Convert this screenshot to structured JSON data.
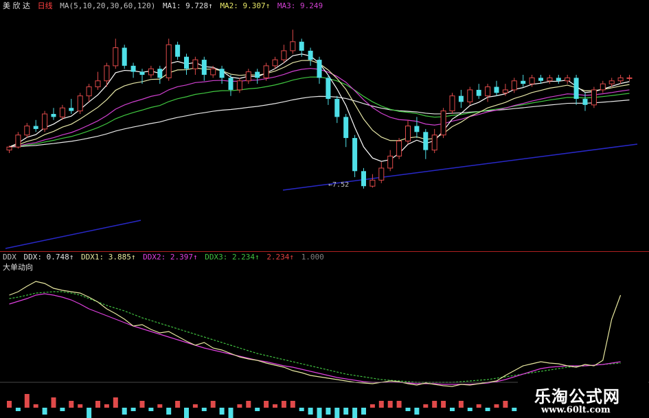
{
  "header": {
    "stock_name": "美 欣 达",
    "period": "日线",
    "ma_def": "MA(5,10,20,30,60,120)",
    "ma1": "MA1: 9.728↑",
    "ma2": "MA2: 9.307↑",
    "ma3": "MA3: 9.249"
  },
  "indicator": {
    "name": "DDX",
    "ddx": "DDX: 0.748↑",
    "ddx1": "DDX1: 3.885↑",
    "ddx2": "DDX2: 2.397↑",
    "ddx3": "DDX3: 2.234↑",
    "v5": "2.234↑",
    "v6": "1.000",
    "subtitle": "大单动向"
  },
  "low_marker": "7.52",
  "watermark": {
    "title": "乐淘公式网",
    "url": "www.60lt.com"
  },
  "colors": {
    "up": "#e04a4a",
    "down": "#4fe0e8",
    "ma5": "#ffffff",
    "ma10": "#e8e8a8",
    "ma20": "#d040d0",
    "ma30": "#40c840",
    "ma60": "#e8e8e8",
    "trend": "#2828c8",
    "ddx2": "#e040e0",
    "ddx3": "#40c040",
    "ddx_line": "#e8e8a0"
  },
  "chart_data": {
    "type": "candlestick",
    "candles": [
      [
        8.8,
        8.9,
        8.95,
        8.7
      ],
      [
        8.9,
        9.3,
        9.4,
        8.85
      ],
      [
        9.3,
        9.6,
        9.7,
        9.2
      ],
      [
        9.6,
        9.5,
        9.8,
        9.4
      ],
      [
        9.5,
        10.0,
        10.1,
        9.4
      ],
      [
        10.0,
        9.9,
        10.2,
        9.8
      ],
      [
        9.9,
        10.2,
        10.3,
        9.8
      ],
      [
        10.2,
        10.1,
        10.5,
        10.0
      ],
      [
        10.1,
        10.6,
        10.7,
        10.0
      ],
      [
        10.6,
        10.9,
        11.0,
        10.4
      ],
      [
        10.9,
        11.1,
        11.4,
        10.8
      ],
      [
        11.1,
        11.6,
        11.7,
        10.9
      ],
      [
        11.6,
        12.2,
        12.5,
        11.5
      ],
      [
        12.2,
        11.6,
        12.3,
        11.5
      ],
      [
        11.6,
        11.4,
        11.7,
        11.2
      ],
      [
        11.4,
        11.3,
        11.5,
        11.0
      ],
      [
        11.3,
        11.5,
        11.6,
        11.2
      ],
      [
        11.5,
        11.2,
        11.6,
        11.0
      ],
      [
        11.2,
        12.3,
        12.5,
        11.1
      ],
      [
        12.3,
        11.9,
        12.4,
        11.8
      ],
      [
        11.9,
        11.5,
        12.0,
        11.3
      ],
      [
        11.5,
        11.8,
        11.9,
        11.3
      ],
      [
        11.8,
        11.3,
        11.9,
        11.1
      ],
      [
        11.3,
        11.5,
        11.6,
        11.2
      ],
      [
        11.5,
        11.2,
        11.6,
        11.0
      ],
      [
        11.2,
        10.8,
        11.3,
        10.6
      ],
      [
        10.8,
        11.1,
        11.2,
        10.7
      ],
      [
        11.1,
        11.4,
        11.5,
        11.0
      ],
      [
        11.4,
        11.2,
        11.5,
        11.0
      ],
      [
        11.2,
        11.6,
        11.7,
        11.1
      ],
      [
        11.6,
        11.8,
        11.9,
        11.5
      ],
      [
        11.8,
        12.1,
        12.3,
        11.7
      ],
      [
        12.1,
        12.4,
        12.8,
        12.0
      ],
      [
        12.4,
        12.1,
        12.5,
        11.9
      ],
      [
        12.1,
        11.8,
        12.2,
        11.6
      ],
      [
        11.8,
        11.2,
        11.9,
        11.0
      ],
      [
        11.2,
        10.5,
        11.3,
        10.3
      ],
      [
        10.5,
        9.9,
        10.6,
        9.7
      ],
      [
        9.9,
        9.2,
        10.0,
        8.9
      ],
      [
        9.2,
        8.1,
        9.3,
        7.9
      ],
      [
        8.1,
        7.6,
        8.2,
        7.52
      ],
      [
        7.6,
        7.8,
        8.0,
        7.55
      ],
      [
        7.8,
        8.2,
        8.4,
        7.7
      ],
      [
        8.2,
        8.6,
        8.8,
        8.1
      ],
      [
        8.6,
        9.1,
        9.2,
        8.5
      ],
      [
        9.1,
        9.6,
        9.8,
        9.0
      ],
      [
        9.6,
        9.4,
        9.9,
        9.2
      ],
      [
        9.4,
        8.8,
        9.5,
        8.5
      ],
      [
        8.8,
        9.3,
        9.5,
        8.7
      ],
      [
        9.3,
        10.1,
        10.2,
        9.2
      ],
      [
        10.1,
        10.6,
        10.7,
        10.0
      ],
      [
        10.6,
        10.4,
        10.8,
        10.2
      ],
      [
        10.4,
        10.8,
        10.9,
        10.3
      ],
      [
        10.8,
        10.6,
        11.0,
        10.5
      ],
      [
        10.6,
        10.9,
        11.0,
        10.4
      ],
      [
        10.9,
        10.7,
        11.1,
        10.6
      ],
      [
        10.7,
        10.8,
        11.0,
        10.6
      ],
      [
        10.8,
        11.1,
        11.2,
        10.7
      ],
      [
        11.1,
        11.0,
        11.3,
        10.9
      ],
      [
        11.0,
        11.2,
        11.3,
        10.9
      ],
      [
        11.2,
        11.1,
        11.3,
        11.0
      ],
      [
        11.1,
        11.2,
        11.3,
        11.0
      ],
      [
        11.2,
        11.1,
        11.3,
        11.0
      ],
      [
        11.1,
        11.2,
        11.3,
        11.0
      ],
      [
        11.2,
        10.5,
        11.3,
        10.3
      ],
      [
        10.5,
        10.3,
        10.7,
        10.1
      ],
      [
        10.3,
        10.8,
        10.9,
        10.2
      ],
      [
        10.8,
        11.0,
        11.1,
        10.7
      ],
      [
        11.0,
        11.1,
        11.2,
        10.9
      ],
      [
        11.1,
        11.2,
        11.3,
        11.0
      ],
      [
        11.2,
        11.2,
        11.3,
        11.1
      ]
    ],
    "volume_bars": [
      2,
      -1,
      4,
      1,
      -2,
      3,
      -1,
      2,
      1,
      -3,
      2,
      1,
      3,
      -2,
      -1,
      2,
      -1,
      1,
      -2,
      2,
      -3,
      1,
      -1,
      2,
      -2,
      -3,
      1,
      2,
      -1,
      2,
      1,
      2,
      2,
      -1,
      -2,
      -3,
      -2,
      -3,
      -2,
      -3,
      -2,
      1,
      2,
      2,
      2,
      -1,
      -2,
      1,
      2,
      2,
      -1,
      2,
      -1,
      1,
      -1,
      1,
      2,
      -1,
      1,
      -1,
      1,
      -1,
      1,
      -3,
      -2,
      2,
      1,
      1,
      1,
      1
    ],
    "ddx_line": [
      1.05,
      1.1,
      1.18,
      1.25,
      1.22,
      1.15,
      1.12,
      1.1,
      1.08,
      1.02,
      0.95,
      0.85,
      0.78,
      0.7,
      0.6,
      0.62,
      0.55,
      0.5,
      0.52,
      0.45,
      0.38,
      0.32,
      0.36,
      0.28,
      0.25,
      0.2,
      0.15,
      0.12,
      0.1,
      0.06,
      0.03,
      0.0,
      -0.05,
      -0.08,
      -0.12,
      -0.14,
      -0.16,
      -0.18,
      -0.2,
      -0.22,
      -0.23,
      -0.24,
      -0.22,
      -0.2,
      -0.21,
      -0.24,
      -0.26,
      -0.23,
      -0.25,
      -0.27,
      -0.28,
      -0.25,
      -0.26,
      -0.24,
      -0.22,
      -0.2,
      -0.12,
      -0.05,
      0.02,
      0.05,
      0.08,
      0.06,
      0.05,
      0.02,
      0.0,
      0.04,
      0.02,
      0.1,
      0.7,
      1.05
    ],
    "ddx2_line": [
      0.92,
      0.96,
      1.0,
      1.05,
      1.07,
      1.05,
      1.02,
      0.98,
      0.92,
      0.85,
      0.8,
      0.75,
      0.7,
      0.65,
      0.6,
      0.56,
      0.52,
      0.48,
      0.44,
      0.4,
      0.36,
      0.32,
      0.28,
      0.25,
      0.22,
      0.19,
      0.16,
      0.13,
      0.1,
      0.08,
      0.05,
      0.02,
      0.0,
      -0.03,
      -0.06,
      -0.09,
      -0.12,
      -0.15,
      -0.17,
      -0.19,
      -0.21,
      -0.22,
      -0.22,
      -0.22,
      -0.22,
      -0.23,
      -0.24,
      -0.24,
      -0.24,
      -0.25,
      -0.25,
      -0.25,
      -0.25,
      -0.24,
      -0.23,
      -0.21,
      -0.18,
      -0.14,
      -0.1,
      -0.06,
      -0.02,
      0.0,
      0.01,
      0.02,
      0.02,
      0.02,
      0.03,
      0.04,
      0.06,
      0.08
    ],
    "ddx3_line": [
      1.0,
      1.02,
      1.05,
      1.08,
      1.09,
      1.1,
      1.1,
      1.08,
      1.05,
      1.0,
      0.95,
      0.9,
      0.86,
      0.82,
      0.77,
      0.72,
      0.68,
      0.64,
      0.6,
      0.56,
      0.52,
      0.48,
      0.44,
      0.4,
      0.36,
      0.32,
      0.28,
      0.24,
      0.2,
      0.17,
      0.14,
      0.11,
      0.08,
      0.05,
      0.02,
      -0.01,
      -0.04,
      -0.07,
      -0.1,
      -0.12,
      -0.14,
      -0.16,
      -0.18,
      -0.19,
      -0.2,
      -0.21,
      -0.22,
      -0.22,
      -0.22,
      -0.22,
      -0.22,
      -0.21,
      -0.2,
      -0.19,
      -0.18,
      -0.16,
      -0.14,
      -0.12,
      -0.1,
      -0.08,
      -0.06,
      -0.04,
      -0.02,
      0.0,
      0.01,
      0.02,
      0.03,
      0.04,
      0.05,
      0.06
    ]
  }
}
